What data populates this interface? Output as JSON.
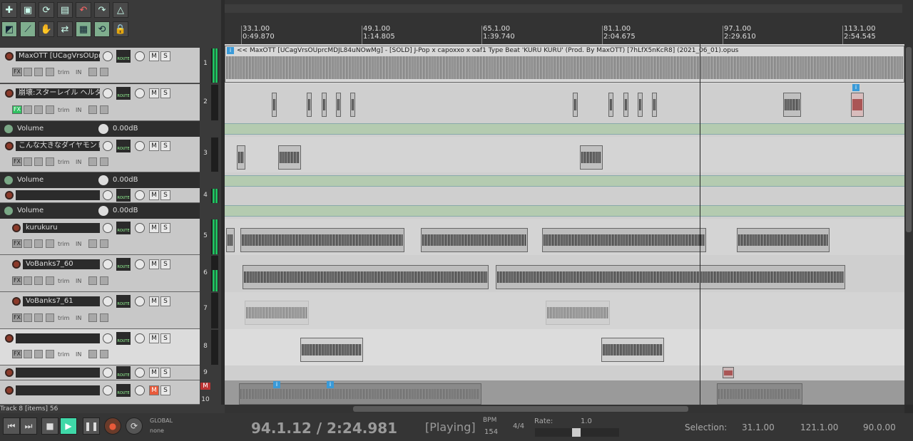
{
  "toolbar": {
    "buttons": [
      "new-project",
      "open-project",
      "render",
      "save",
      "undo",
      "redo",
      "metronome",
      "snap",
      "ripple",
      "grid",
      "repeat",
      "lock",
      "envelope",
      "item-grouping"
    ]
  },
  "ruler": {
    "marks": [
      {
        "bar": "33.1.00",
        "time": "0:49.870"
      },
      {
        "bar": "49.1.00",
        "time": "1:14.805"
      },
      {
        "bar": "65.1.00",
        "time": "1:39.740"
      },
      {
        "bar": "81.1.00",
        "time": "2:04.675"
      },
      {
        "bar": "97.1.00",
        "time": "2:29.610"
      },
      {
        "bar": "113.1.00",
        "time": "2:54.545"
      }
    ]
  },
  "tracks": [
    {
      "number": "1",
      "name": "MaxOTT [UCagVrsOUprc",
      "fx_active": false
    },
    {
      "number": "2",
      "name": "崩壊:スターレイル ヘルタ",
      "fx_active": true
    },
    {
      "number": "3",
      "name": "こんな大きなダイヤモンド見た",
      "fx_active": false
    },
    {
      "number": "4",
      "name": "",
      "fx_active": false
    },
    {
      "number": "5",
      "name": "kurukuru",
      "fx_active": false
    },
    {
      "number": "6",
      "name": "VoBanks7_60",
      "fx_active": false
    },
    {
      "number": "7",
      "name": "VoBanks7_61",
      "fx_active": false
    },
    {
      "number": "8",
      "name": "",
      "fx_active": false
    },
    {
      "number": "9",
      "name": "",
      "fx_active": false
    },
    {
      "number": "10",
      "name": "",
      "fx_active": false
    }
  ],
  "labels": {
    "fx": "FX",
    "trim": "trim",
    "in": "IN",
    "mute": "M",
    "solo": "S",
    "route": "ROUTE",
    "master_marker": "M"
  },
  "envelopes": [
    {
      "name": "Volume",
      "value": "0.00dB"
    },
    {
      "name": "Volume",
      "value": "0.00dB"
    },
    {
      "name": "Volume",
      "value": "0.00dB"
    }
  ],
  "item_title": "<< MaxOTT [UCagVrsOUprcMDJL84uNOwMg] - [SOLD] J-Pop x capoxxo x oaf1 Type Beat 'KURU KURU' (Prod. By MaxOTT) [7hLfX5nKcR8] (2021_06_01).opus",
  "item_info_badge": "i",
  "status": "Track 8 [items] 56",
  "transport": {
    "position": "94.1.12 / 2:24.981",
    "state": "[Playing]",
    "bpm_label": "BPM",
    "bpm": "154",
    "time_sig": "4/4",
    "rate_label": "Rate:",
    "rate": "1.0",
    "global_label": "GLOBAL",
    "global_mode": "none",
    "selection_label": "Selection:",
    "selection_start": "31.1.00",
    "selection_end": "121.1.00",
    "selection_length": "90.0.00"
  }
}
